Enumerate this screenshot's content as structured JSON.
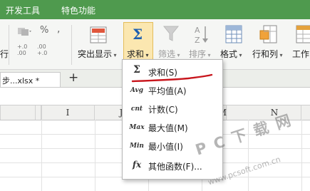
{
  "menubar": {
    "items": [
      "开发工具",
      "特色功能"
    ]
  },
  "ribbon": {
    "percent": "%",
    "comma": ",",
    "decimals_up": "+.0\n.00",
    "decimals_down": ".00\n+.0",
    "highlight_label": "突出显示",
    "sum_label": "求和",
    "filter_label": "筛选",
    "sort_label": "排序",
    "format_label": "格式",
    "rowcol_label": "行和列",
    "worksheet_label": "工作",
    "row_label": "行"
  },
  "tabs": {
    "file_tab": "步...xlsx *",
    "add_tab": "+"
  },
  "columns": [
    "I",
    "J",
    "K",
    "L",
    "M",
    "N"
  ],
  "sum_menu": {
    "items": [
      {
        "icon": "Σ",
        "label": "求和(S)"
      },
      {
        "icon": "Avg",
        "label": "平均值(A)"
      },
      {
        "icon": "cnt",
        "label": "计数(C)"
      },
      {
        "icon": "Max",
        "label": "最大值(M)"
      },
      {
        "icon": "Min",
        "label": "最小值(I)"
      },
      {
        "icon": "fx",
        "label": "其他函数(F)..."
      }
    ]
  },
  "watermark": {
    "brand": "P C 下 载 网",
    "url": "www.pcsoft.com.cn"
  },
  "colors": {
    "menubar": "#4f9a4e",
    "annotation": "#c8161d",
    "sum_highlight": "#fbe7b0"
  }
}
